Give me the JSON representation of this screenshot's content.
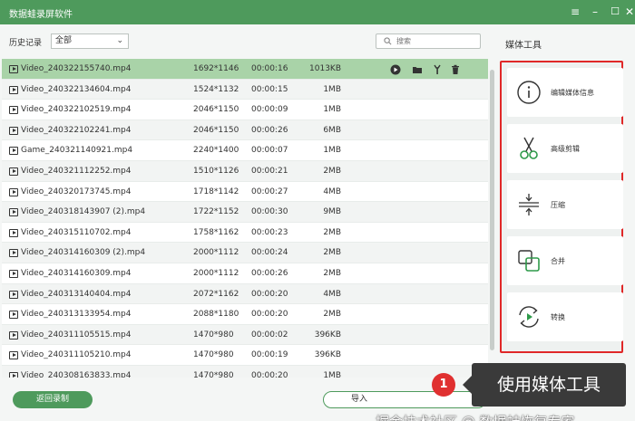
{
  "window": {
    "title": "数据蛙录屏软件",
    "buttons": [
      "menu-icon",
      "minimize-icon",
      "maximize-icon",
      "close-icon"
    ]
  },
  "filter": {
    "history_label": "历史记录",
    "selected": "全部",
    "search_placeholder": "搜索"
  },
  "files": [
    {
      "name": "Video_240322155740.mp4",
      "resolution": "1692*1146",
      "duration": "00:00:16",
      "size": "1013KB",
      "selected": true
    },
    {
      "name": "Video_240322134604.mp4",
      "resolution": "1524*1132",
      "duration": "00:00:15",
      "size": "1MB"
    },
    {
      "name": "Video_240322102519.mp4",
      "resolution": "2046*1150",
      "duration": "00:00:09",
      "size": "1MB"
    },
    {
      "name": "Video_240322102241.mp4",
      "resolution": "2046*1150",
      "duration": "00:00:26",
      "size": "6MB"
    },
    {
      "name": "Game_240321140921.mp4",
      "resolution": "2240*1400",
      "duration": "00:00:07",
      "size": "1MB"
    },
    {
      "name": "Video_240321112252.mp4",
      "resolution": "1510*1126",
      "duration": "00:00:21",
      "size": "2MB"
    },
    {
      "name": "Video_240320173745.mp4",
      "resolution": "1718*1142",
      "duration": "00:00:27",
      "size": "4MB"
    },
    {
      "name": "Video_240318143907 (2).mp4",
      "resolution": "1722*1152",
      "duration": "00:00:30",
      "size": "9MB"
    },
    {
      "name": "Video_240315110702.mp4",
      "resolution": "1758*1162",
      "duration": "00:00:23",
      "size": "2MB"
    },
    {
      "name": "Video_240314160309 (2).mp4",
      "resolution": "2000*1112",
      "duration": "00:00:24",
      "size": "2MB"
    },
    {
      "name": "Video_240314160309.mp4",
      "resolution": "2000*1112",
      "duration": "00:00:26",
      "size": "2MB"
    },
    {
      "name": "Video_240313140404.mp4",
      "resolution": "2072*1162",
      "duration": "00:00:20",
      "size": "4MB"
    },
    {
      "name": "Video_240313133954.mp4",
      "resolution": "2088*1180",
      "duration": "00:00:20",
      "size": "2MB"
    },
    {
      "name": "Video_240311105515.mp4",
      "resolution": "1470*980",
      "duration": "00:00:02",
      "size": "396KB"
    },
    {
      "name": "Video_240311105210.mp4",
      "resolution": "1470*980",
      "duration": "00:00:19",
      "size": "396KB"
    },
    {
      "name": "Video_240308163833.mp4",
      "resolution": "1470*980",
      "duration": "00:00:20",
      "size": "1MB"
    }
  ],
  "row_actions": [
    "play-icon",
    "folder-icon",
    "tools-icon",
    "delete-icon"
  ],
  "footer": {
    "back_label": "返回录制",
    "import_label": "导入"
  },
  "sidebar": {
    "title": "媒体工具",
    "tools": [
      {
        "icon": "info-icon",
        "label": "编辑媒体信息"
      },
      {
        "icon": "scissors-icon",
        "label": "高级剪辑"
      },
      {
        "icon": "compress-icon",
        "label": "压缩"
      },
      {
        "icon": "merge-icon",
        "label": "合并"
      },
      {
        "icon": "convert-icon",
        "label": "转换"
      }
    ]
  },
  "callout": {
    "number": "1",
    "text": "使用媒体工具"
  },
  "watermark": "掘金技术社区 @ 数据蛙恢复专家",
  "colors": {
    "brand": "#4e9a5c",
    "selected_row": "#a9d3a8",
    "highlight_border": "#e02828",
    "callout_bg": "#3a3a3a"
  }
}
